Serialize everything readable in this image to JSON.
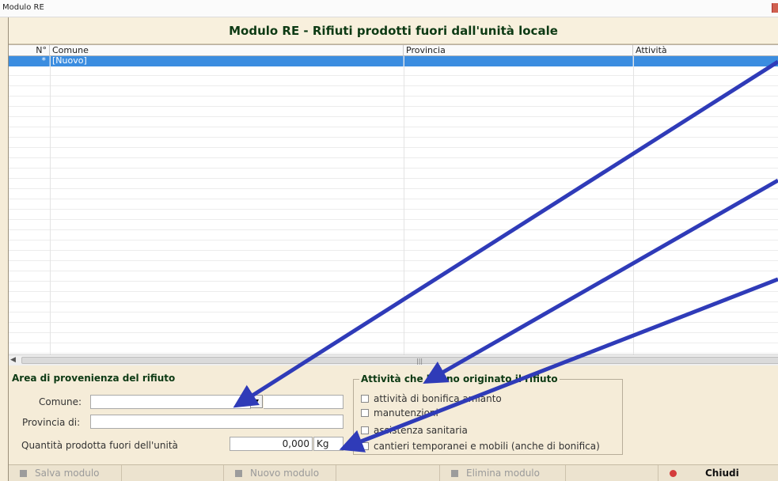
{
  "window": {
    "title": "Modulo RE"
  },
  "banner": {
    "title": "Modulo RE - Rifiuti prodotti fuori dall'unità locale"
  },
  "grid": {
    "columns": [
      "N°",
      "Comune",
      "Provincia",
      "Attività"
    ],
    "new_row": {
      "marker": "*",
      "comune": "[Nuovo]",
      "provincia": "",
      "attivita": ""
    }
  },
  "area": {
    "title": "Area di provenienza del rifiuto",
    "comune_label": "Comune:",
    "comune_value": "",
    "provincia_label": "Provincia di:",
    "provincia_value": "",
    "quantita_label": "Quantità prodotta fuori dell'unità",
    "quantita_value": "0,000",
    "unit": "Kg"
  },
  "attivita": {
    "title": "Attività che hanno originato il rifiuto",
    "options": [
      {
        "label": "attività di bonifica amianto",
        "checked": false
      },
      {
        "label": "manutenzioni",
        "checked": false
      },
      {
        "label": "assistenza sanitaria",
        "checked": false
      },
      {
        "label": "cantieri temporanei e mobili (anche di bonifica)",
        "checked": false
      }
    ]
  },
  "toolbar": {
    "save_label": "Salva modulo",
    "new_label": "Nuovo modulo",
    "delete_label": "Elimina modulo",
    "close_label": "Chiudi"
  },
  "colors": {
    "accent_row": "#3b8de0",
    "title_green": "#0d3a14",
    "arrow": "#2f3bb8",
    "panel": "#f5ecd8"
  }
}
